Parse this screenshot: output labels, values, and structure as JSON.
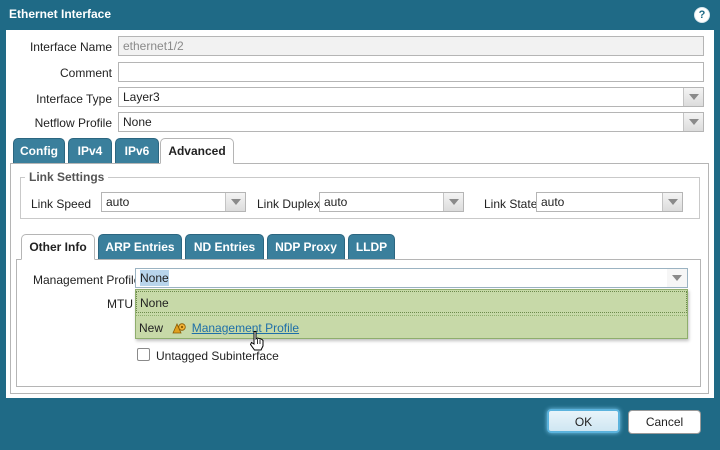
{
  "window": {
    "title": "Ethernet Interface",
    "help_glyph": "?"
  },
  "form": {
    "interface_name": {
      "label": "Interface Name",
      "value": "ethernet1/2"
    },
    "comment": {
      "label": "Comment",
      "value": ""
    },
    "interface_type": {
      "label": "Interface Type",
      "value": "Layer3"
    },
    "netflow_profile": {
      "label": "Netflow Profile",
      "value": "None"
    }
  },
  "main_tabs": [
    {
      "label": "Config",
      "active": false
    },
    {
      "label": "IPv4",
      "active": false
    },
    {
      "label": "IPv6",
      "active": false
    },
    {
      "label": "Advanced",
      "active": true
    }
  ],
  "link_settings": {
    "legend": "Link Settings",
    "link_speed": {
      "label": "Link Speed",
      "value": "auto"
    },
    "link_duplex": {
      "label": "Link Duplex",
      "value": "auto"
    },
    "link_state": {
      "label": "Link State",
      "value": "auto"
    }
  },
  "sub_tabs": [
    {
      "label": "Other Info",
      "active": true
    },
    {
      "label": "ARP Entries",
      "active": false
    },
    {
      "label": "ND Entries",
      "active": false
    },
    {
      "label": "NDP Proxy",
      "active": false
    },
    {
      "label": "LLDP",
      "active": false
    }
  ],
  "other_info": {
    "management_profile": {
      "label": "Management Profile",
      "value": "None"
    },
    "mtu": {
      "label": "MTU"
    },
    "dropdown": {
      "options": [
        "None"
      ],
      "new_label": "New",
      "new_link": "Management Profile"
    },
    "untagged": {
      "label": "Untagged Subinterface",
      "checked": false
    }
  },
  "footer": {
    "ok_label": "OK",
    "cancel_label": "Cancel"
  },
  "colors": {
    "header": "#1f6a86",
    "tab": "#3a7f9c",
    "dropdown": "#c7d9a8"
  }
}
